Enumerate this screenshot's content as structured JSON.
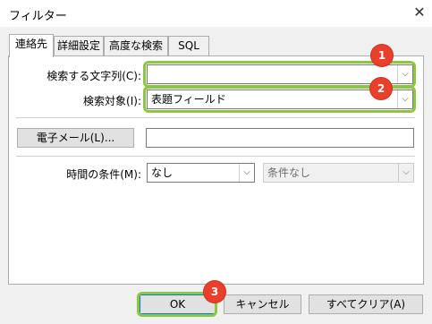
{
  "window": {
    "title": "フィルター",
    "close_glyph": "✕"
  },
  "tabs": [
    "連絡先",
    "詳細設定",
    "高度な検索",
    "SQL"
  ],
  "fields": {
    "search_text_label": "検索する文字列(C):",
    "search_text_value": "",
    "search_target_label": "検索対象(I):",
    "search_target_value": "表題フィールド",
    "email_button": "電子メール(L)...",
    "email_value": "",
    "time_label": "時間の条件(M):",
    "time_value": "なし",
    "time_condition_value": "条件なし"
  },
  "buttons": {
    "ok": "OK",
    "cancel": "キャンセル",
    "clear_all": "すべてクリア(A)"
  },
  "annotations": {
    "badge1": "1",
    "badge2": "2",
    "badge3": "3",
    "highlight_color": "#8dc63f",
    "badge_color": "#e8402a"
  }
}
